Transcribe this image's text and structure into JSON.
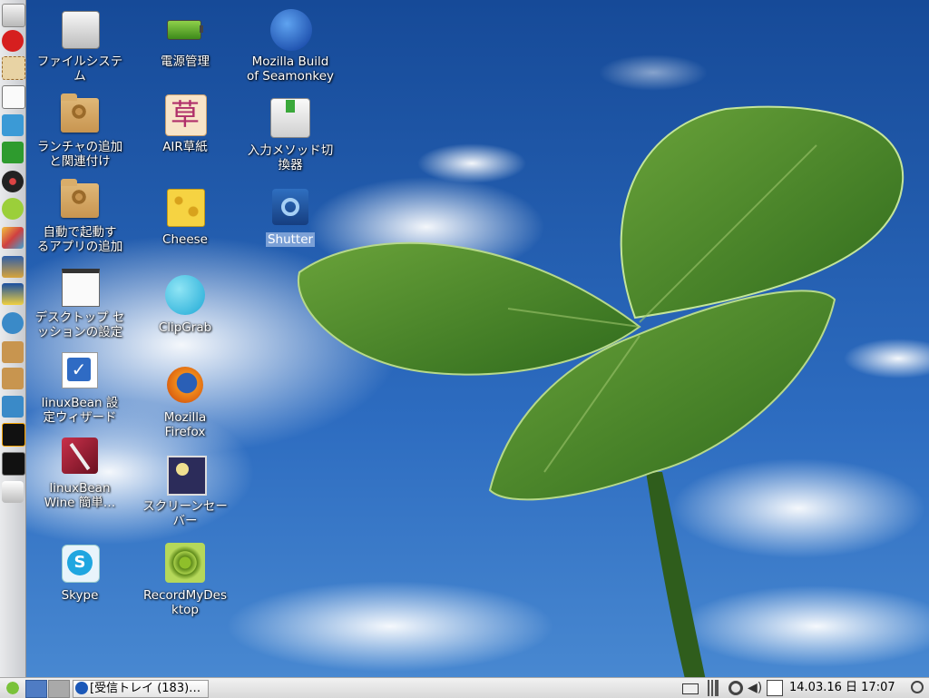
{
  "desktop": {
    "icons": [
      {
        "label": "ファイルシステ\nム"
      },
      {
        "label": "ランチャの追加\nと関連付け"
      },
      {
        "label": "自動で起動す\nるアプリの追加"
      },
      {
        "label": "デスクトップ セ\nッションの設定"
      },
      {
        "label": "linuxBean 設\n定ウィザード"
      },
      {
        "label": "linuxBean\nWine 簡単…"
      },
      {
        "label": "Skype"
      },
      {
        "label": "電源管理"
      },
      {
        "label": "AIR草紙"
      },
      {
        "label": "Cheese"
      },
      {
        "label": "ClipGrab"
      },
      {
        "label": "Mozilla\nFirefox"
      },
      {
        "label": "スクリーンセー\nバー"
      },
      {
        "label": "RecordMyDes\nktop"
      },
      {
        "label": "Mozilla Build\nof Seamonkey"
      },
      {
        "label": "入力メソッド切\n換器"
      },
      {
        "label": "Shutter"
      }
    ],
    "airsoshi_glyph": "草"
  },
  "dock": {
    "items": [
      "file-manager",
      "opera",
      "mail-stamp",
      "text-editor",
      "network-manager",
      "green-app",
      "media-player",
      "bug-app",
      "paint",
      "image-viewer",
      "pidgin",
      "wifi",
      "package-install",
      "package-add",
      "printer",
      "system-monitor",
      "terminal",
      "trash"
    ]
  },
  "taskbar": {
    "task_label": "[受信トレイ (183)…",
    "datetime": "14.03.16 日 17:07"
  },
  "colors": {
    "sky": "#2a63b8",
    "leaf": "#4f8a2e",
    "taskbar": "#e2e2e2",
    "selection": "#7ba0d6"
  }
}
